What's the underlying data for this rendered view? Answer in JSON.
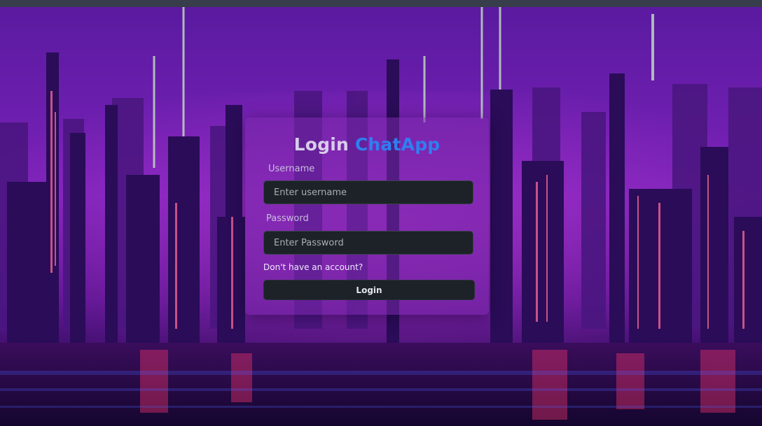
{
  "login": {
    "title_prefix": "Login",
    "title_brand": "ChatApp",
    "username_label": "Username",
    "username_placeholder": "Enter username",
    "password_label": "Password",
    "password_placeholder": "Enter Password",
    "signup_link": "Don't have an account?",
    "submit_label": "Login"
  },
  "colors": {
    "brand_accent": "#2f7ff0",
    "input_bg": "#1c2228",
    "card_bg": "rgba(120,40,170,0.55)"
  }
}
